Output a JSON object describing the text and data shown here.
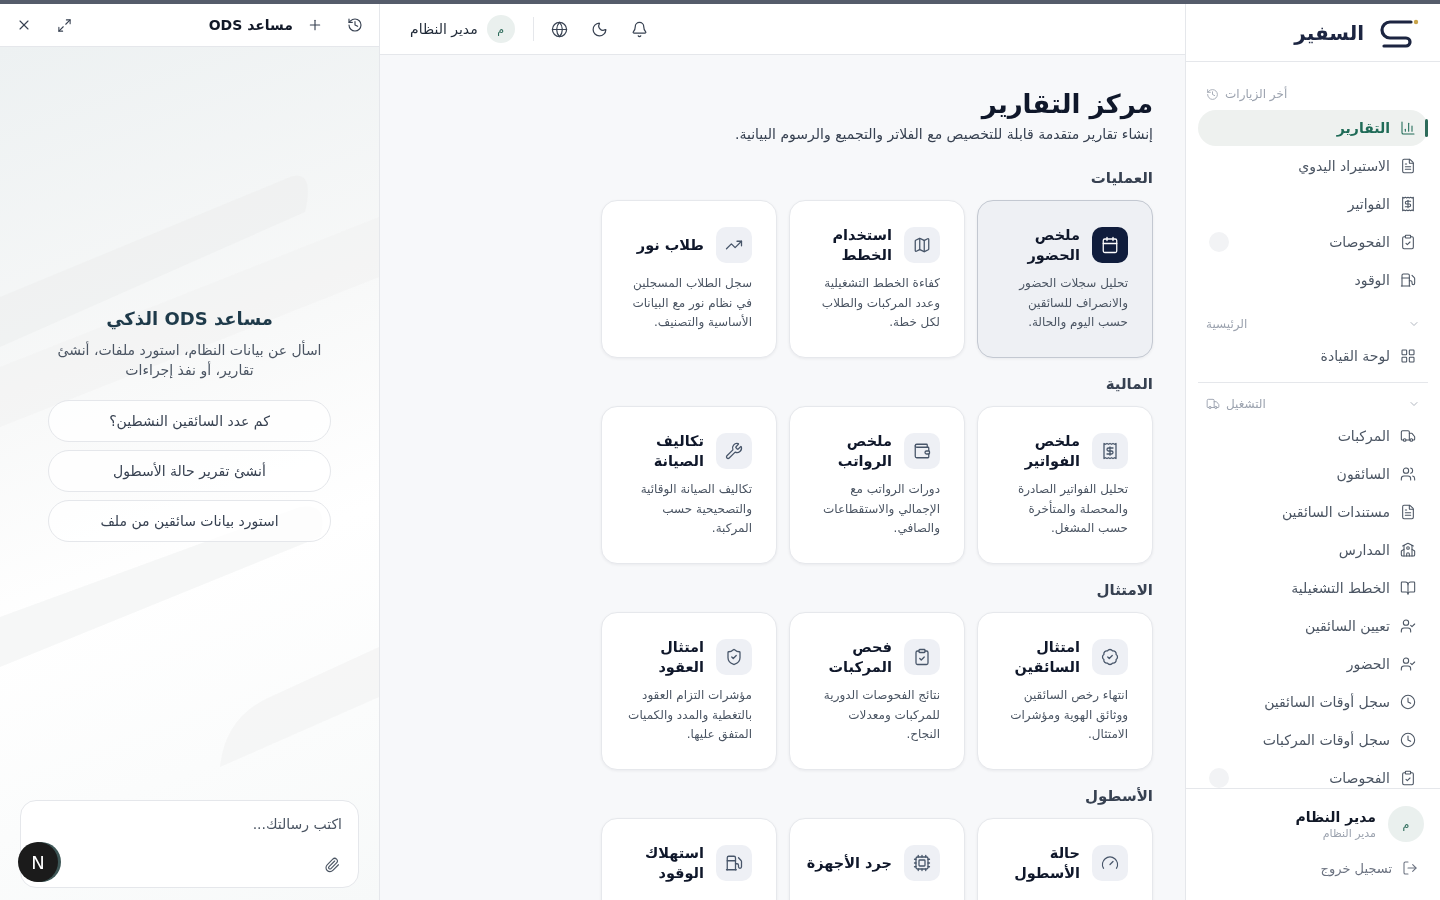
{
  "top_header": {
    "user_initial": "م",
    "user_name": "مدير النظام"
  },
  "page": {
    "title": "مركز التقارير",
    "subtitle": "إنشاء تقارير متقدمة قابلة للتخصيص مع الفلاتر والتجميع والرسوم البيانية.",
    "sections": [
      {
        "title": "العمليات",
        "reports": [
          {
            "title": "ملخص الحضور",
            "description": "تحليل سجلات الحضور والانصراف للسائقين حسب اليوم والحالة.",
            "selected": true
          },
          {
            "title": "استخدام الخطط",
            "description": "كفاءة الخطط التشغيلية وعدد المركبات والطلاب لكل خطة.",
            "selected": false
          },
          {
            "title": "طلاب نور",
            "description": "سجل الطلاب المسجلين في نظام نور مع البيانات الأساسية والتصنيف.",
            "selected": false
          }
        ]
      },
      {
        "title": "المالية",
        "reports": [
          {
            "title": "ملخص الفواتير",
            "description": "تحليل الفواتير الصادرة والمحصلة والمتأخرة حسب المشغل.",
            "selected": false
          },
          {
            "title": "ملخص الرواتب",
            "description": "دورات الرواتب مع الإجمالي والاستقطاعات والصافي.",
            "selected": false
          },
          {
            "title": "تكاليف الصيانة",
            "description": "تكاليف الصيانة الوقائية والتصحيحية حسب المركبة.",
            "selected": false
          }
        ]
      },
      {
        "title": "الامتثال",
        "reports": [
          {
            "title": "امتثال السائقين",
            "description": "انتهاء رخص السائقين ووثائق الهوية ومؤشرات الامتثال.",
            "selected": false
          },
          {
            "title": "فحص المركبات",
            "description": "نتائج الفحوصات الدورية للمركبات ومعدلات النجاح.",
            "selected": false
          },
          {
            "title": "امتثال العقود",
            "description": "مؤشرات التزام العقود بالتغطية والمدد والكميات المتفق عليها.",
            "selected": false
          }
        ]
      },
      {
        "title": "الأسطول",
        "reports": [
          {
            "title": "حالة الأسطول",
            "selected": false
          },
          {
            "title": "جرد الأجهزة",
            "selected": false
          },
          {
            "title": "استهلاك الوقود",
            "selected": false
          }
        ]
      }
    ]
  },
  "sidebar": {
    "logo_text": "السفير",
    "recent": {
      "title": "أخر الزيارات",
      "items": [
        {
          "label": "التقارير",
          "selected": true,
          "badge": false
        },
        {
          "label": "الاستيراد اليدوي",
          "selected": false,
          "badge": false
        },
        {
          "label": "الفواتير",
          "selected": false,
          "badge": false
        },
        {
          "label": "الفحوصات",
          "selected": false,
          "badge": true
        },
        {
          "label": "الوقود",
          "selected": false,
          "badge": false
        }
      ]
    },
    "groups": [
      {
        "title": "الرئيسية",
        "expanded": true,
        "items": [
          {
            "label": "لوحة القيادة",
            "selected": false,
            "badge": false
          }
        ]
      },
      {
        "title": "التشغيل",
        "expanded": true,
        "items": [
          {
            "label": "المركبات",
            "selected": false,
            "badge": false
          },
          {
            "label": "السائقون",
            "selected": false,
            "badge": false
          },
          {
            "label": "مستندات السائقين",
            "selected": false,
            "badge": false
          },
          {
            "label": "المدارس",
            "selected": false,
            "badge": false
          },
          {
            "label": "الخطط التشغيلية",
            "selected": false,
            "badge": false
          },
          {
            "label": "تعيين السائقين",
            "selected": false,
            "badge": false
          },
          {
            "label": "الحضور",
            "selected": false,
            "badge": false
          },
          {
            "label": "سجل أوقات السائقين",
            "selected": false,
            "badge": false
          },
          {
            "label": "سجل أوقات المركبات",
            "selected": false,
            "badge": false
          },
          {
            "label": "الفحوصات",
            "selected": false,
            "badge": true
          }
        ]
      }
    ],
    "user": {
      "initial": "م",
      "name": "مدير النظام",
      "role": "مدير النظام"
    },
    "logout": "تسجيل خروج"
  },
  "assistant": {
    "title": "مساعد ODS",
    "heading": "مساعد ODS الذكي",
    "description": "اسأل عن بيانات النظام، استورد ملفات، أنشئ تقارير، أو نفذ إجراءات",
    "suggestions": [
      "كم عدد السائقين النشطين؟",
      "أنشئ تقرير حالة الأسطول",
      "استورد بيانات سائقين من ملف"
    ],
    "input": {
      "placeholder": "اكتب رسالتك..."
    }
  },
  "dev_tools_button": {
    "label": "N"
  }
}
